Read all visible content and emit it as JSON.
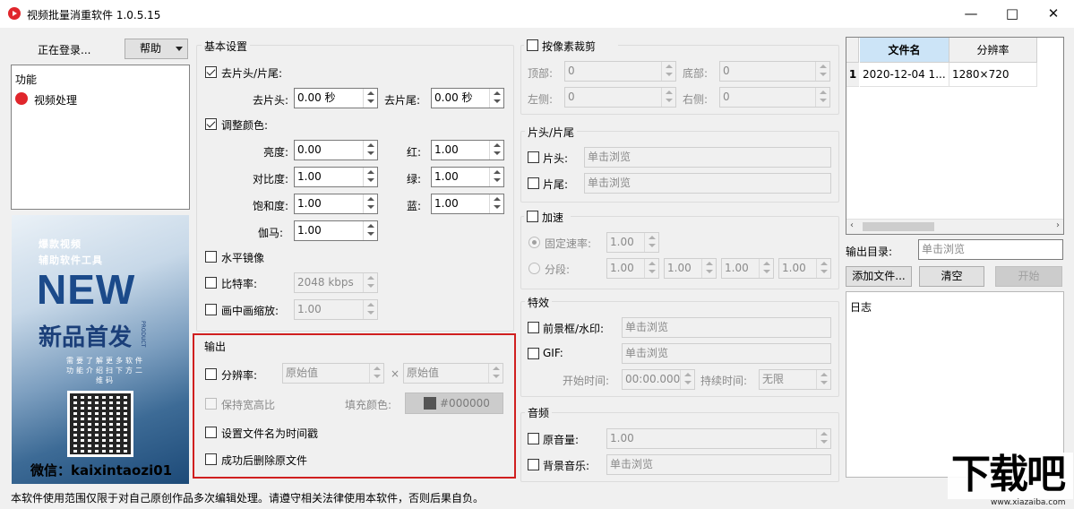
{
  "window": {
    "title": "视频批量消重软件 1.0.5.15"
  },
  "left": {
    "status": "正在登录...",
    "help_button": "帮助",
    "func_header": "功能",
    "func_item": "视频处理",
    "ad": {
      "line1": "爆款视频",
      "line2": "辅助软件工具",
      "big": "NEW",
      "sub": "新品首发",
      "tag": "PRODUCT",
      "desc": "需要了解更多软件功能介绍扫下方二维码",
      "wechat": "微信：kaixintaozi01"
    }
  },
  "basic": {
    "title": "基本设置",
    "trim_check": "去片头/片尾:",
    "head_label": "去片头:",
    "head_value": "0.00 秒",
    "tail_label": "去片尾:",
    "tail_value": "0.00 秒",
    "color_check": "调整颜色:",
    "brightness_label": "亮度:",
    "brightness": "0.00",
    "contrast_label": "对比度:",
    "contrast": "1.00",
    "saturation_label": "饱和度:",
    "saturation": "1.00",
    "gamma_label": "伽马:",
    "gamma": "1.00",
    "red_label": "红:",
    "red": "1.00",
    "green_label": "绿:",
    "green": "1.00",
    "blue_label": "蓝:",
    "blue": "1.00",
    "mirror_check": "水平镜像",
    "bitrate_check": "比特率:",
    "bitrate": "2048 kbps",
    "pip_check": "画中画缩放:",
    "pip": "1.00"
  },
  "output": {
    "title": "输出",
    "res_check": "分辨率:",
    "res_w": "原始值",
    "times": "×",
    "res_h": "原始值",
    "keep_ratio": "保持宽高比",
    "fill_label": "填充颜色:",
    "fill_color": "#000000",
    "timestamp_check": "设置文件名为时间戳",
    "delete_check": "成功后删除原文件"
  },
  "crop": {
    "check": "按像素裁剪",
    "top_label": "顶部:",
    "top": "0",
    "bottom_label": "底部:",
    "bottom": "0",
    "left_label": "左侧:",
    "left": "0",
    "right_label": "右侧:",
    "right": "0"
  },
  "headtail": {
    "title": "片头/片尾",
    "head_check": "片头:",
    "head_ph": "单击浏览",
    "tail_check": "片尾:",
    "tail_ph": "单击浏览"
  },
  "speed": {
    "check": "加速",
    "fixed_label": "固定速率:",
    "fixed": "1.00",
    "seg_label": "分段:",
    "seg": [
      "1.00",
      "1.00",
      "1.00",
      "1.00"
    ]
  },
  "effects": {
    "title": "特效",
    "fg_check": "前景框/水印:",
    "fg_ph": "单击浏览",
    "gif_check": "GIF:",
    "gif_ph": "单击浏览",
    "start_label": "开始时间:",
    "start": "00:00.000",
    "dur_label": "持续时间:",
    "dur": "无限"
  },
  "audio": {
    "title": "音频",
    "orig_check": "原音量:",
    "orig": "1.00",
    "bgm_check": "背景音乐:",
    "bgm_ph": "单击浏览"
  },
  "files": {
    "col_name": "文件名",
    "col_res": "分辨率",
    "rows": [
      {
        "idx": "1",
        "name": "2020-12-04 1...",
        "res": "1280×720"
      }
    ]
  },
  "right": {
    "out_dir_label": "输出目录:",
    "out_dir_ph": "单击浏览",
    "add_button": "添加文件...",
    "clear_button": "清空",
    "start_button": "开始",
    "log_title": "日志"
  },
  "footer": {
    "notice": "本软件使用范围仅限于对自己原创作品多次编辑处理。请遵守相关法律使用本软件，否则后果自负。"
  },
  "watermark": {
    "text": "下载吧",
    "url": "www.xiazaiba.com"
  }
}
